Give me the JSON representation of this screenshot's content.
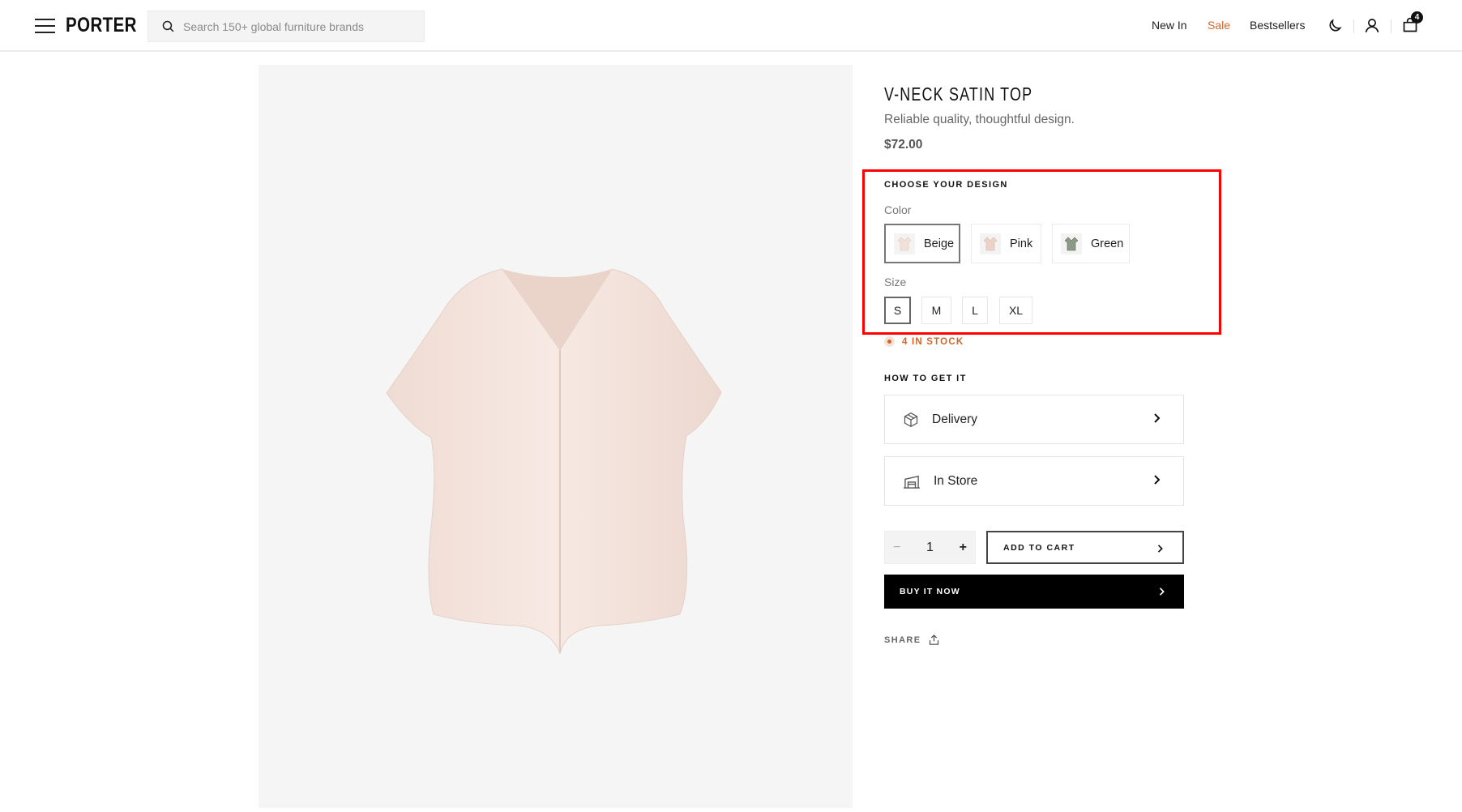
{
  "header": {
    "logo": "PORTER",
    "search_placeholder": "Search 150+ global furniture brands",
    "nav": [
      "New In",
      "Sale",
      "Bestsellers"
    ],
    "sale_color": "#d2642a",
    "cart_count": "4",
    "icons": [
      "menu-icon",
      "search-icon",
      "moon-icon",
      "user-icon",
      "bag-icon"
    ]
  },
  "product": {
    "title": "V-NECK SATIN TOP",
    "subtitle": "Reliable quality, thoughtful design.",
    "price": "$72.00",
    "image_color": "#f3e3dc"
  },
  "design": {
    "heading": "CHOOSE YOUR DESIGN",
    "color_label": "Color",
    "colors": [
      {
        "name": "Beige",
        "selected": true
      },
      {
        "name": "Pink",
        "selected": false
      },
      {
        "name": "Green",
        "selected": false
      }
    ],
    "size_label": "Size",
    "sizes": [
      {
        "name": "S",
        "selected": true
      },
      {
        "name": "M",
        "selected": false
      },
      {
        "name": "L",
        "selected": false
      },
      {
        "name": "XL",
        "selected": false
      }
    ],
    "highlight_color": "#ff0000"
  },
  "stock": {
    "text": "4 IN STOCK",
    "color": "#d2642a"
  },
  "fulfillment": {
    "heading": "HOW TO GET IT",
    "options": [
      {
        "label": "Delivery",
        "icon": "box-icon"
      },
      {
        "label": "In Store",
        "icon": "store-icon"
      }
    ]
  },
  "purchase": {
    "quantity": "1",
    "minus": "−",
    "plus": "+",
    "add_to_cart": "ADD TO CART",
    "buy_now": "BUY IT NOW",
    "share": "SHARE"
  }
}
